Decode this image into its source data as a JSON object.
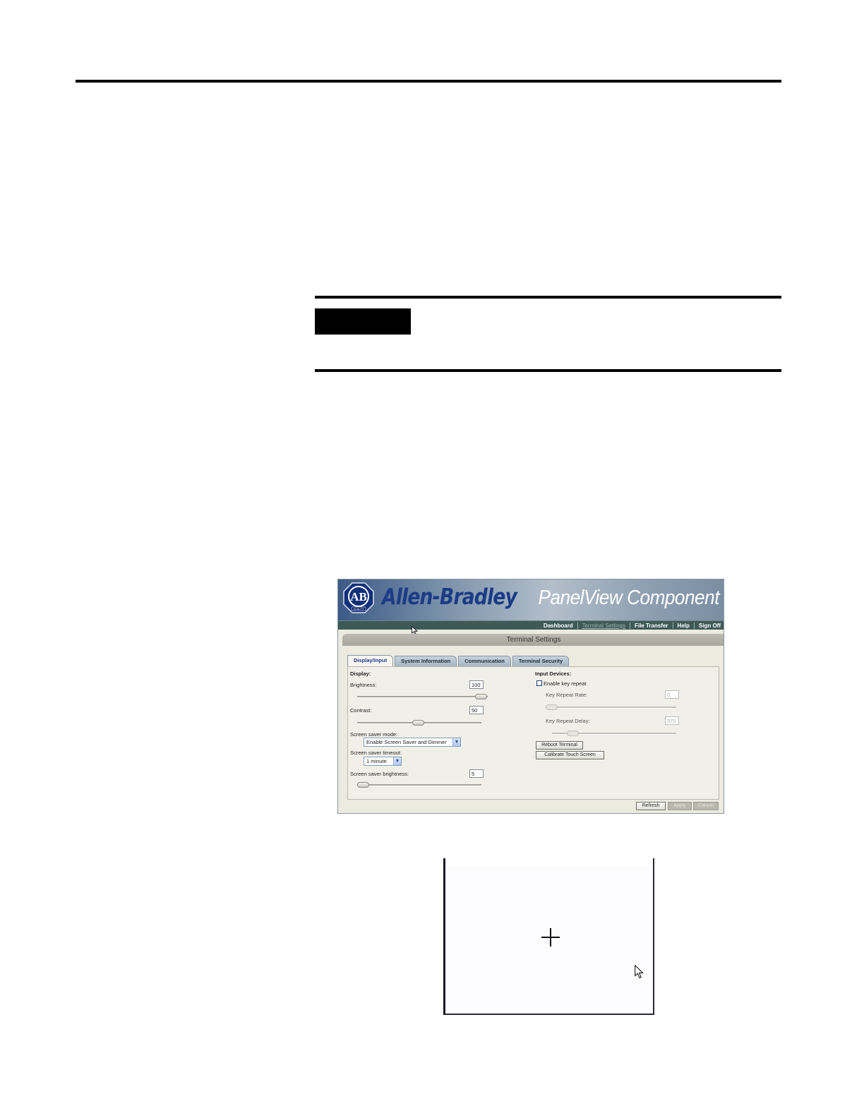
{
  "panelview": {
    "brand": "Allen-Bradley",
    "product": "PanelView Component",
    "logo_text": "AB",
    "logo_subtext": "QUALITY",
    "nav": [
      "Dashboard",
      "Terminal Settings",
      "File Transfer",
      "Help",
      "Sign Off"
    ],
    "active_nav": "Terminal Settings",
    "panel_title": "Terminal Settings",
    "tabs": [
      "Display/Input",
      "System Information",
      "Communication",
      "Terminal Security"
    ],
    "active_tab": "Display/Input",
    "display": {
      "heading": "Display:",
      "brightness_label": "Brightness:",
      "brightness_value": "100",
      "brightness_level": 1.0,
      "contrast_label": "Contrast:",
      "contrast_value": "50",
      "contrast_level": 0.5,
      "screen_saver_mode_label": "Screen saver mode:",
      "screen_saver_mode_value": "Enable Screen Saver and Dimmer",
      "screen_saver_timeout_label": "Screen saver timeout:",
      "screen_saver_timeout_value": "1 minute",
      "screen_saver_brightness_label": "Screen saver brightness:",
      "screen_saver_brightness_value": "5",
      "screen_saver_brightness_level": 0.05
    },
    "input": {
      "heading": "Input Devices:",
      "key_repeat_label": "Enable key repeat",
      "key_repeat_checked": false,
      "rate_label": "Key Repeat Rate:",
      "rate_value": "0",
      "rate_level": 0.0,
      "delay_label": "Key Repeat Delay:",
      "delay_value": "375",
      "delay_level": 0.17,
      "reboot_label": "Reboot Terminal",
      "calibrate_label": "Calibrate Touch Screen"
    },
    "buttons": {
      "refresh": "Refresh",
      "apply": "Apply",
      "cancel": "Cancel"
    }
  },
  "colors": {
    "brand_blue": "#1b3b86",
    "nav_bar": "#3e5a57",
    "panel_bg": "#ecebe0"
  }
}
